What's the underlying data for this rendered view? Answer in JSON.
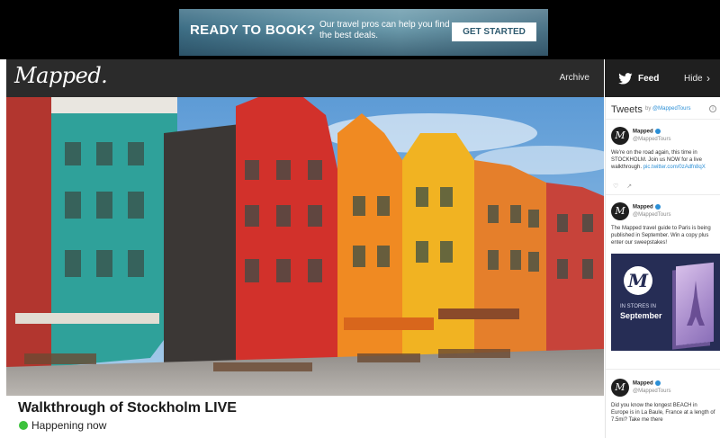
{
  "ad": {
    "headline": "READY TO BOOK?",
    "subtext": "Our travel pros can help you find the best deals.",
    "cta": "GET STARTED"
  },
  "header": {
    "logo": "Mapped.",
    "archive": "Archive"
  },
  "feed": {
    "label": "Feed",
    "hide": "Hide",
    "chevron": "›",
    "icon": "twitter-icon"
  },
  "stream": {
    "title": "Walkthrough of Stockholm LIVE",
    "status": "Happening now",
    "status_color": "#3cc23c"
  },
  "sidebar": {
    "title": "Tweets",
    "by": "by",
    "handle": "@MappedTours",
    "info": "i",
    "tweets": [
      {
        "name": "Mapped",
        "handle": "@MappedTours",
        "text": "We're on the road again, this time in STOCKHOLM. Join us NOW for a live walkthrough.",
        "link": "pic.twitter.com/0zAdfn8qX"
      },
      {
        "name": "Mapped",
        "handle": "@MappedTours",
        "text": "The Mapped travel guide to Paris is being published in September. Win a copy plus enter our sweepstakes!",
        "link": ""
      },
      {
        "name": "Mapped",
        "handle": "@MappedTours",
        "text": "Did you know the longest BEACH in Europe is in La Baule, France at a length of 7.5mi? Take me there",
        "link": ""
      }
    ],
    "promo": {
      "logo": "M",
      "line1": "IN STORES IN",
      "line2": "September"
    },
    "avatar_letter": "M"
  },
  "colors": {
    "header_bg": "#2b2b2b",
    "feed_bg": "#1f1f1f",
    "link": "#2b8fd6",
    "promo_bg": "#262d55"
  }
}
